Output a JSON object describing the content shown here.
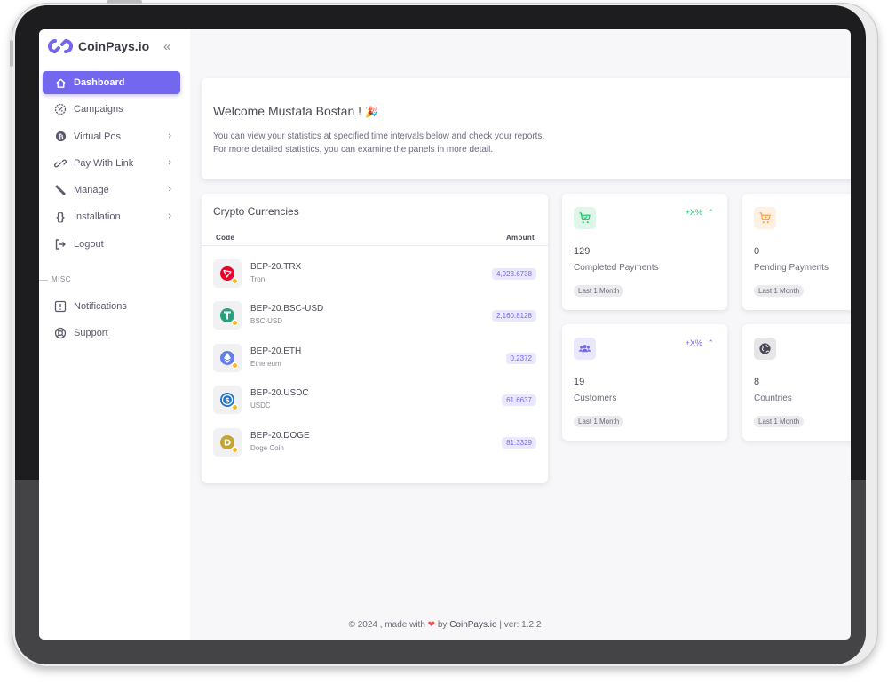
{
  "brand": {
    "name": "CoinPays.io",
    "color": "#7367f0"
  },
  "sidebar": {
    "collapse_icon": "double-chevron-left-icon",
    "items": [
      {
        "label": "Dashboard",
        "icon": "home-icon",
        "active": true,
        "has_submenu": false
      },
      {
        "label": "Campaigns",
        "icon": "badge-discount-icon",
        "active": false,
        "has_submenu": false
      },
      {
        "label": "Virtual Pos",
        "icon": "bitcoin-icon",
        "active": false,
        "has_submenu": true
      },
      {
        "label": "Pay With Link",
        "icon": "link-icon",
        "active": false,
        "has_submenu": true
      },
      {
        "label": "Manage",
        "icon": "tools-icon",
        "active": false,
        "has_submenu": true
      },
      {
        "label": "Installation",
        "icon": "code-braces-icon",
        "active": false,
        "has_submenu": true
      },
      {
        "label": "Logout",
        "icon": "logout-icon",
        "active": false,
        "has_submenu": false
      }
    ],
    "misc_label": "MISC",
    "misc_items": [
      {
        "label": "Notifications",
        "icon": "alert-square-icon"
      },
      {
        "label": "Support",
        "icon": "lifebuoy-icon"
      }
    ]
  },
  "welcome": {
    "title": "Welcome Mustafa Bostan !",
    "emoji": "🎉",
    "line1": "You can view your statistics at specified time intervals below and check your reports.",
    "line2": "For more detailed statistics, you can examine the panels in more detail."
  },
  "crypto": {
    "title": "Crypto Currencies",
    "col_code": "Code",
    "col_amount": "Amount",
    "rows": [
      {
        "code": "BEP-20.TRX",
        "name": "Tron",
        "amount": "4,923.6738",
        "icon": "tron-icon",
        "color": "#eb0029"
      },
      {
        "code": "BEP-20.BSC-USD",
        "name": "BSC-USD",
        "amount": "2,160.8128",
        "icon": "tether-icon",
        "color": "#26a17b"
      },
      {
        "code": "BEP-20.ETH",
        "name": "Ethereum",
        "amount": "0.2372",
        "icon": "ethereum-icon",
        "color": "#627eea"
      },
      {
        "code": "BEP-20.USDC",
        "name": "USDC",
        "amount": "61.6637",
        "icon": "usdc-icon",
        "color": "#2775ca"
      },
      {
        "code": "BEP-20.DOGE",
        "name": "Doge Coin",
        "amount": "81.3329",
        "icon": "dogecoin-icon",
        "color": "#c2a633"
      }
    ]
  },
  "stats": [
    {
      "value": "129",
      "label": "Completed Payments",
      "badge": "Last 1 Month",
      "trend": "+X%",
      "trend_color": "#28c76f",
      "icon": "cart-check-icon",
      "icon_color": "#28c76f",
      "icon_bg": "#dff7e9"
    },
    {
      "value": "0",
      "label": "Pending Payments",
      "badge": "Last 1 Month",
      "trend": "",
      "trend_color": "",
      "icon": "cart-clock-icon",
      "icon_color": "#ff9f43",
      "icon_bg": "#fff0e1"
    },
    {
      "value": "19",
      "label": "Customers",
      "badge": "Last 1 Month",
      "trend": "+X%",
      "trend_color": "#7367f0",
      "icon": "users-icon",
      "icon_color": "#7367f0",
      "icon_bg": "#eae8fd"
    },
    {
      "value": "8",
      "label": "Countries",
      "badge": "Last 1 Month",
      "trend": "",
      "trend_color": "",
      "icon": "globe-icon",
      "icon_color": "#4b4858",
      "icon_bg": "#e6e6e8"
    }
  ],
  "footer": {
    "prefix": "© 2024 , made with",
    "heart": "❤",
    "by": "by",
    "brand": "CoinPays.io",
    "version": "| ver: 1.2.2"
  }
}
